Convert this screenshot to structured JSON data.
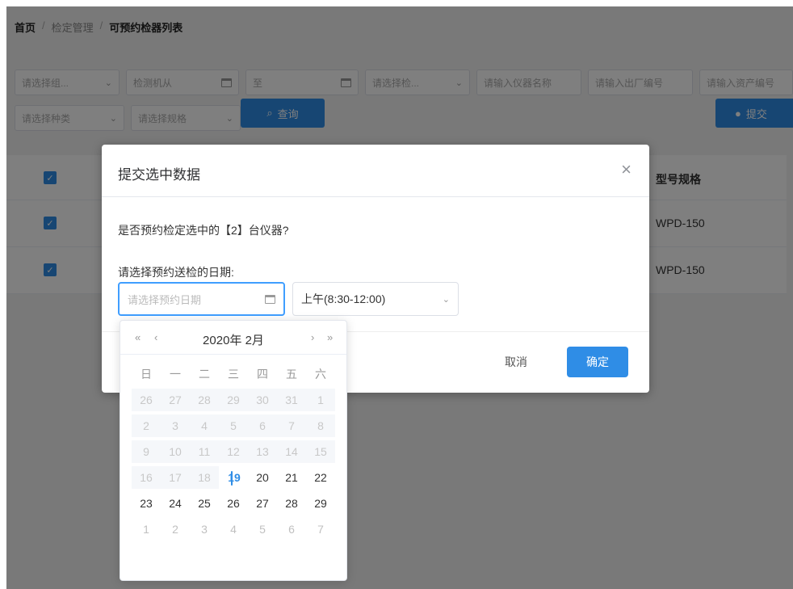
{
  "breadcrumb": {
    "home": "首页",
    "middle": "检定管理",
    "current": "可预约检器列表"
  },
  "filters": {
    "row1": [
      "请选择组...",
      "检测机从",
      "至",
      "请选择检...",
      "请输入仪器名称",
      "请输入出厂编号",
      "请输入资产编号"
    ],
    "row2": [
      "请选择种类",
      "请选择规格"
    ],
    "query_label": "查询",
    "submit_label": "提交"
  },
  "table": {
    "header_model": "型号规格",
    "rows": [
      {
        "model": "WPD-150"
      },
      {
        "model": "WPD-150"
      }
    ]
  },
  "dialog": {
    "title": "提交选中数据",
    "message": "是否预约检定选中的【2】台仪器?",
    "date_label": "请选择预约送检的日期:",
    "date_placeholder": "请选择预约日期",
    "time_value": "上午(8:30-12:00)",
    "cancel_label": "取消",
    "ok_label": "确定"
  },
  "calendar": {
    "title": "2020年 2月",
    "weekdays": [
      "日",
      "一",
      "二",
      "三",
      "四",
      "五",
      "六"
    ],
    "rows": [
      [
        "26",
        "27",
        "28",
        "29",
        "30",
        "31",
        "1"
      ],
      [
        "2",
        "3",
        "4",
        "5",
        "6",
        "7",
        "8"
      ],
      [
        "9",
        "10",
        "11",
        "12",
        "13",
        "14",
        "15"
      ],
      [
        "16",
        "17",
        "18",
        "19",
        "20",
        "21",
        "22"
      ],
      [
        "23",
        "24",
        "25",
        "26",
        "27",
        "28",
        "29"
      ],
      [
        "1",
        "2",
        "3",
        "4",
        "5",
        "6",
        "7"
      ]
    ],
    "today": "19"
  },
  "colors": {
    "accent": "#2f8de6",
    "focus": "#409eff"
  }
}
